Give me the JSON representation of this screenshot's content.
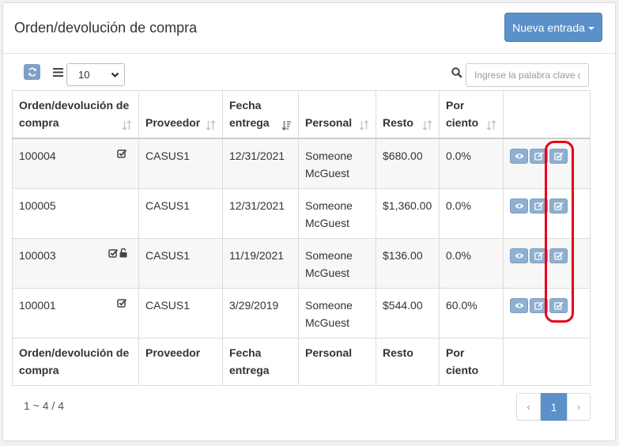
{
  "header": {
    "title": "Orden/devolución de compra",
    "new_button": "Nueva entrada"
  },
  "toolbar": {
    "page_size": "10",
    "search_placeholder": "Ingrese la palabra clave d"
  },
  "columns": [
    "Orden/devolución de compra",
    "Proveedor",
    "Fecha entrega",
    "Personal",
    "Resto",
    "Por ciento"
  ],
  "rows": [
    {
      "id": "100004",
      "icons": [
        "check-square-icon"
      ],
      "supplier": "CASUS1",
      "date": "12/31/2021",
      "staff": "Someone McGuest",
      "rest": "$680.00",
      "percent": "0.0%"
    },
    {
      "id": "100005",
      "icons": [],
      "supplier": "CASUS1",
      "date": "12/31/2021",
      "staff": "Someone McGuest",
      "rest": "$1,360.00",
      "percent": "0.0%"
    },
    {
      "id": "100003",
      "icons": [
        "check-square-icon",
        "unlock-icon"
      ],
      "supplier": "CASUS1",
      "date": "11/19/2021",
      "staff": "Someone McGuest",
      "rest": "$136.00",
      "percent": "0.0%"
    },
    {
      "id": "100001",
      "icons": [
        "check-square-icon"
      ],
      "supplier": "CASUS1",
      "date": "3/29/2019",
      "staff": "Someone McGuest",
      "rest": "$544.00",
      "percent": "60.0%"
    }
  ],
  "footer": {
    "info": "1 ~ 4 / 4",
    "prev": "‹",
    "current_page": "1",
    "next": "›"
  },
  "colors": {
    "accent": "#5b90c9",
    "action_button": "#8fb0cf",
    "highlight": "#e8001a"
  }
}
